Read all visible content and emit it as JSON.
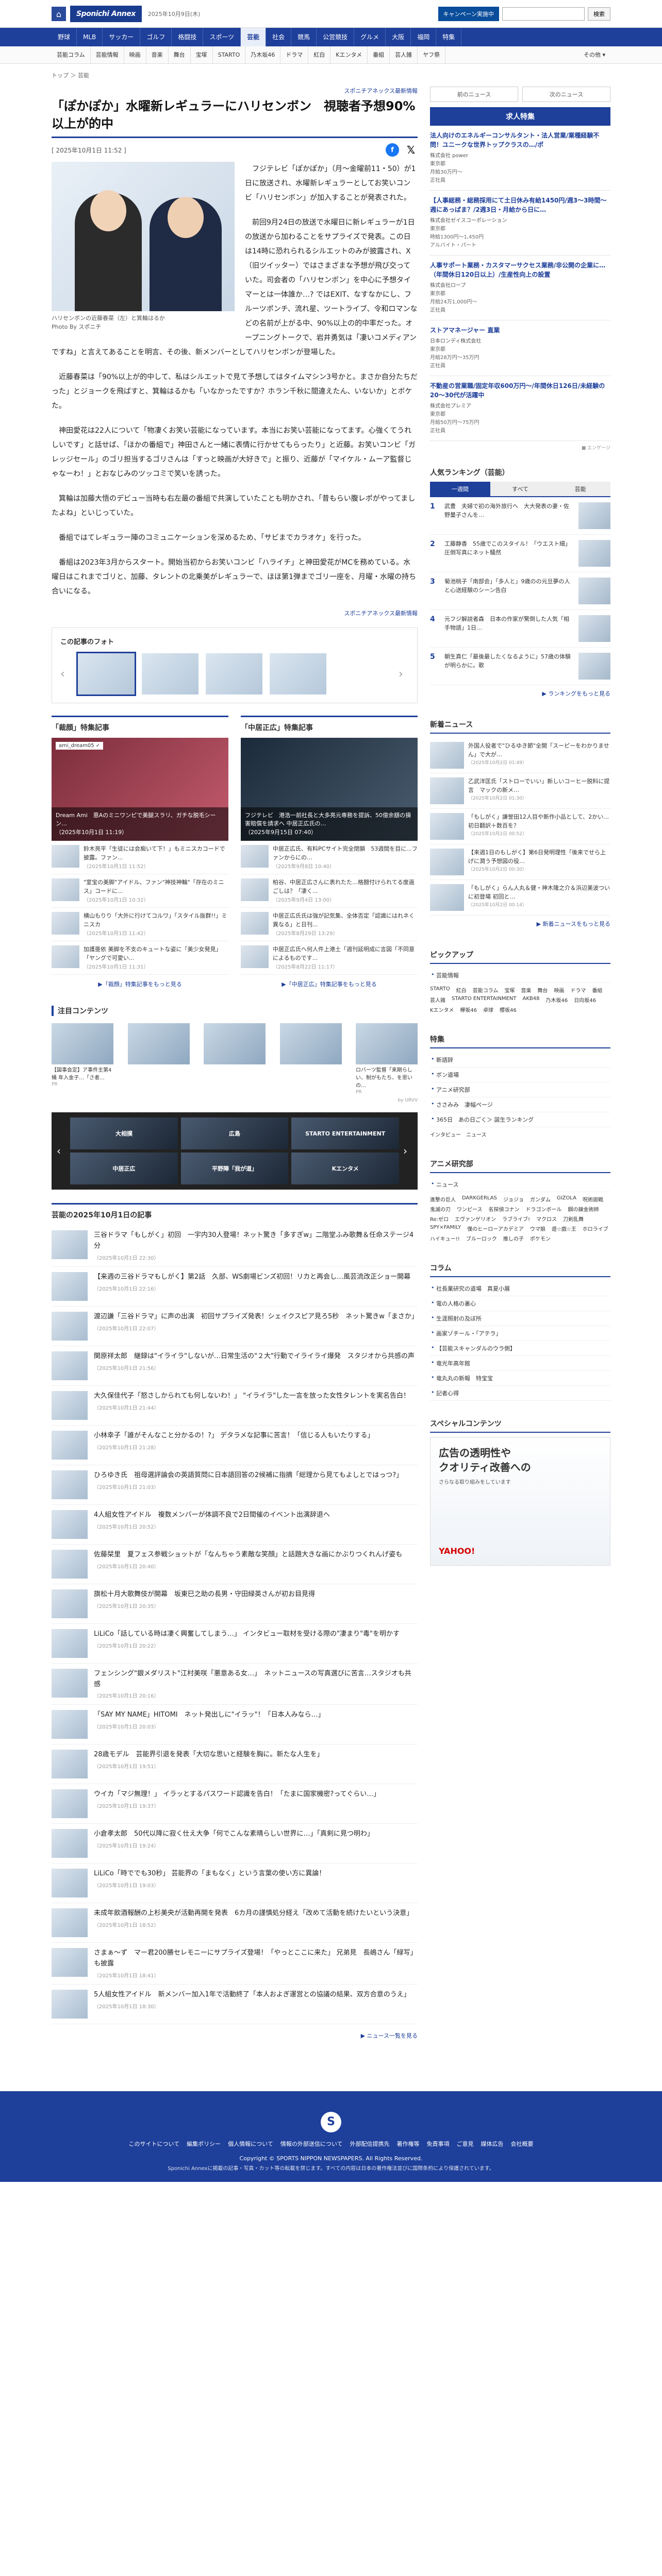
{
  "header": {
    "logo_text": "Sponichi Annex",
    "date": "2025年10月9日(木)",
    "subscribe_label": "キャンペーン実施中",
    "search_placeholder": "",
    "search_button": "検索"
  },
  "nav_main": [
    "野球",
    "MLB",
    "サッカー",
    "ゴルフ",
    "格闘技",
    "スポーツ",
    "芸能",
    "社会",
    "競馬",
    "公営競技",
    "グルメ",
    "大阪",
    "福岡",
    "特集"
  ],
  "nav_main_active": "芸能",
  "nav_sub": [
    "芸能コラム",
    "芸能情報",
    "映画",
    "音楽",
    "舞台",
    "宝塚",
    "STARTO",
    "乃木坂46",
    "ドラマ",
    "紅白",
    "Kエンタメ",
    "番組",
    "芸人雑",
    "ヤフ祭"
  ],
  "nav_sub_more": "その他",
  "breadcrumb": "トップ ＞ 芸能",
  "prev_label": "前のニュース",
  "next_label": "次のニュース",
  "article": {
    "pr_tag": "スポニチアネックス最新情報",
    "title": "「ぽかぽか」水曜新レギュラーにハリセンボン　視聴者予想90%以上が的中",
    "date": "[ 2025年10月1日 11:52 ]",
    "caption": "ハリセンボンの近藤春菜（左）と箕輪はるか\nPhoto By スポニチ",
    "paragraphs": [
      "フジテレビ「ぽかぽか」（月～金曜前11・50）が1日に放送され、水曜新レギュラーとしてお笑いコンビ「ハリセンボン」が加入することが発表された。",
      "前回9月24日の放送で水曜日に新レギュラーが1日の放送から加わることをサプライズで発表。この日は14時に恐れられるシルエットのみが披露され、X（旧ツイッター）ではさまざまな予想が飛び交っていた。司会者の「ハリセンボン」を中心に予想タイマーとは一体誰か…? ではEXIT、なすなかにし、フルーツポンチ、流れ星、ツートライブ、令和ロマンなどの名前が上がる中、90%以上の的中率だった。オープニングトークで、岩井勇気は「凄いコメディアンですね」と言えてあることを明言、その後、新メンバーとしてハリセンボンが登場した。",
      "近藤春菜は「90%以上が的中して、私はシルエットで見て予想してはタイムマシン3号かと。まさか自分たちだった」とジョークを飛ばすと、箕輪はるかも「いなかったですか？ホラン千秋に間違えたん、いないか」とボケた。",
      "神田愛花は22人について「物凄くお笑い芸能になっています。本当にお笑い芸能になってます。心強くてうれしいです」と話せば、「ほかの番組で」神田さんと一緒に表情に行かせてもらったり」と近藤。お笑いコンビ「ガレッジセール」のゴリ担当するゴリさんは「すっと映画が大好きで」と振り、近藤が「マイケル・ムーア監督じゃなーわ！」とおなじみのツッコミで笑いを誘った。",
      "箕輪は加藤大悟のデビュー当時も右左最の番組で共演していたことも明かされ、「昔もらい腹レポがやってましたよね」といじっていた。",
      "番組ではてレギュラー陣のコミュニケーションを深めるため、「サビまでカラオケ」を行った。",
      "番組は2023年3月からスタート。開始当初からお笑いコンビ「ハライチ」と神田愛花がMCを務めている。水曜日はこれまでゴリと、加藤、タレントの北乗美がレギュラーで、ほほ第1弾までゴリ一座を、月曜・水曜の持ち合いになる。"
    ],
    "pr_tag2": "スポニチアネックス最新情報"
  },
  "photo_gallery": {
    "title": "この記事のフォト",
    "count": 4
  },
  "features": [
    {
      "title": "「裁顔」特集記事",
      "hero_tag": "ami_dream05 ✓",
      "hero_text": "Dream Ami　恩Aのミニワンピで美腿スラリ、ガチな脱毛シーン…",
      "hero_date": "（2025年10月1日 11:19）",
      "items": [
        {
          "text": "鈴木亮平「生徒には会痴いて下！」もミニスカコードで披露。ファン...",
          "date": "（2025年10月1日 11:52）"
        },
        {
          "text": "\"室宝の美脚\"アイドル、ファン\"神技神輪\"「存在のミニス」コードに...",
          "date": "（2025年10月1日 10:32）"
        },
        {
          "text": "横山もりり「大外に行けてコルワ」「スタイル抜群!!」ミニスカ",
          "date": "（2025年10月1日 11:42）"
        },
        {
          "text": "加護亜依 美脚を不支のキュートな姿に「美少女発見」「ヤングで可愛い...",
          "date": "（2025年10月1日 11:31）"
        }
      ],
      "more": "▶「裁顔」特集記事をもっと見る"
    },
    {
      "title": "「中居正広」特集記事",
      "hero_tag": "",
      "hero_text": "フジテレビ　港浩一前社長と大多亮元専務を提訴、50億余額の損害賠償を請求へ 中居正広氏の…",
      "hero_date": "（2025年9月15日 07:40）",
      "items": [
        {
          "text": "中居正広氏、有料PCサイト完全閉鎖　53週間を目に...ファンからにの...",
          "date": "（2025年9月8日 10:40）"
        },
        {
          "text": "柏谷、中居正広さんに表れたた…格闘付けられてる度過ごしは？「凄く...",
          "date": "（2025年9月4日 13:00）"
        },
        {
          "text": "中居正広氏氏は強が記気集、全体否定「認識にはれネく異なる」と日刊...",
          "date": "（2025年8月29日 13:29）"
        },
        {
          "text": "中居正広氏へ何人件上港土「週刊延明成に言図「不同意によるものです...",
          "date": "（2025年8月22日 11:17）"
        }
      ],
      "more": "▶「中居正広」特集記事をもっと見る"
    }
  ],
  "attention": {
    "title": "注目コンテンツ",
    "items": [
      {
        "text": "【図事会定】ア事件主第4桶 年入金子…「さ者...",
        "pr": "PR"
      },
      {
        "text": "",
        "pr": ""
      },
      {
        "text": "",
        "pr": ""
      },
      {
        "text": "",
        "pr": ""
      },
      {
        "text": "ロバーツ監督「来期らしい、制がもたち、を思いの…",
        "pr": "PR"
      }
    ],
    "credit": "by URVV"
  },
  "carousel": [
    "大相撲",
    "広島",
    "STARTO ENTERTAINMENT",
    "中居正広",
    "平野陣「我が道」",
    "Kエンタメ"
  ],
  "news_list": {
    "title": "芸能の2025年10月1日の記事",
    "items": [
      {
        "title": "三谷ドラマ「もしがく」初回　一宇内30人登場！ネット驚き「多すぎw」二階堂ふみ歌舞＆任命ステージ4分",
        "date": "（2025年10月1日 22:30）"
      },
      {
        "title": "【来週の三谷ドラマもしがく】第2話　久部、WS劇場ビンズ初回！リカと再会し…風芸流改正ショー開幕",
        "date": "（2025年10月1日 22:16）"
      },
      {
        "title": "渡辺謙「三谷ドラマ」に声の出演　初回サプライズ発表！シェイクスピア見ろ5秒　ネット驚きw「まさか」",
        "date": "（2025年10月1日 22:07）"
      },
      {
        "title": "関原祥太郎　継録は\"イライラ\"しないが…日常生活の\"２大\"行動でイライライ爆発　スタジオから共感の声",
        "date": "（2025年10月1日 21:56）"
      },
      {
        "title": "大久保佳代子「怒さしかられても何しないわ！」 \"イライラ\"した一言を放った女性タレントを実名告白！",
        "date": "（2025年10月1日 21:44）"
      },
      {
        "title": "小林幸子「誰がそんなこと分かるの！?」 デタラメな記事に苦言！「信じる人もいたりする」",
        "date": "（2025年10月1日 21:28）"
      },
      {
        "title": "ひろゆき氏　祖母選評論会の英語質問に日本語回答の2候補に指摘「総理から見てもよしとではっつ?」",
        "date": "（2025年10月1日 21:03）"
      },
      {
        "title": "4人組女性アイドル　複数メンバーが体調不良で2日間催のイベント出演辞退へ",
        "date": "（2025年10月1日 20:52）"
      },
      {
        "title": "佐藤栞里　夏フェス参戦ショットが「なんちゃう素敵な笑顔」と話題大きな画にかぶりつくれんげ姿も",
        "date": "（2025年10月1日 20:40）"
      },
      {
        "title": "旗松十月大歌舞伎が開幕　坂東巳之助の長男・守田緑英さんが初お目見得",
        "date": "（2025年10月1日 20:35）"
      },
      {
        "title": "LiLiCo「話している時は凄く興奮してしまう…」 インタビュー取材を受ける際の\"凄まり\"毒\"を明かす",
        "date": "（2025年10月1日 20:22）"
      },
      {
        "title": "フェンシング\"銀メダリスト\"江村美咲「悪意ある女…」　ネットニュースの写真選びに苦言…スタジオも共感",
        "date": "（2025年10月1日 20:16）"
      },
      {
        "title": "「SAY MY NAME」HITOMI　ネット発出しに\"イラッ\"！「日本人みなら…」",
        "date": "（2025年10月1日 20:03）"
      },
      {
        "title": "28歳モデル　芸能界引退を発表「大切な思いと経験を胸に。新たな人生を」",
        "date": "（2025年10月1日 19:51）"
      },
      {
        "title": "ウイカ「マジ無理！」 イラッとするパスワード認識を告白！「たまに国家機密?ってぐらい…」",
        "date": "（2025年10月1日 19:37）"
      },
      {
        "title": "小倉孝太郎　50代以降に寂く仕え大争「何でこんな素晴らしい世界に…」「真剣に見つ明わ」",
        "date": "（2025年10月1日 19:24）"
      },
      {
        "title": "LiLiCo「時ででも30秒」 芸能界の「まもなく」という言葉の使い方に異論！",
        "date": "（2025年10月1日 19:03）"
      },
      {
        "title": "未成年飲酒報酬の上杉美央が活動再開を発表　6カ月の謹慎処分経え「改めて活動を続けたいという決意」",
        "date": "（2025年10月1日 18:52）"
      },
      {
        "title": "さまぁ～ず　マー君200勝セレモニーにサプライズ登場！「やっとここに来た」 兄弟見　長嶋さん「緑写」も披露",
        "date": "（2025年10月1日 18:41）"
      },
      {
        "title": "5人組女性アイドル　新メンバー加入1年で活動終了「本人およぎ運営との協議の結果、双方合意のうえ」",
        "date": "（2025年10月1日 18:30）"
      }
    ],
    "more": "▶ ニュース一覧を見る"
  },
  "sidebar": {
    "prev": "前のニュース",
    "next": "次のニュース",
    "jobs_title": "求人特集",
    "jobs": [
      {
        "title": "法人向けのエネルギーコンサルタント・法人営業/業種経験不問！ユニークな世界トップクラスの…/ポ",
        "co": "株式会社 power",
        "det": "東京都\n月給30万円～\n正社員"
      },
      {
        "title": "【人事総務・総務採用にて土日休み有給1450円/週3～3時間～週にあっぱま？/2週3日・月給から日に…",
        "co": "株式会社ゼイスコーポレーション",
        "det": "東京都\n時給1300円～1,450円\nアルバイト・パート"
      },
      {
        "title": "人事サポート業務・カスタマーサクセス業務/非公開の企業に…（年間休日120日以上）/生産性向上の設置",
        "co": "株式会社ロープ",
        "det": "東京都\n月給24万1,000円～\n正社員"
      },
      {
        "title": "ストアマネージャー 直業",
        "co": "日本ロンディ株式会社",
        "det": "東京都\n月給28万円～35万円\n正社員"
      },
      {
        "title": "不動産の営業職/固定年収600万円～/年間休日126日/未経験の20～30代が活躍中",
        "co": "株式会社プレミア",
        "det": "東京都\n月給50万円～75万円\n正社員"
      }
    ],
    "jobs_credit": "■ エンゲージ",
    "ranking_title": "人気ランキング（芸能）",
    "ranking_tabs": [
      "一週間",
      "すべて",
      "芸能"
    ],
    "ranking_active": 0,
    "ranking": [
      {
        "no": "1",
        "text": "武豊　夫婦で初の海外旅行へ　大大発表の妻・佐野量子さんを…"
      },
      {
        "no": "2",
        "text": "工藤静香　55歳でこのスタイル！「ウエスト細」圧倒写真にネット騒然"
      },
      {
        "no": "3",
        "text": "菊池桃子「南部会」「多人と」9歳のの元旦夢の人と心送経験のシーン告白"
      },
      {
        "no": "4",
        "text": "元フジ解説者森　日本の作家が驚倒した人気「相手物語」1日…"
      },
      {
        "no": "5",
        "text": "朝生真仁「最後最したくなるように」57歳の体験が明らかに。歌"
      }
    ],
    "ranking_more": "▶ ランキングをもっと見る",
    "new_title": "新着ニュース",
    "new_items": [
      {
        "text": "外国人役者で\"ひるゆき節\"全開「スーピーをわかりません」で大が…",
        "date": "（2025年10月2日 01:49）"
      },
      {
        "text": "乙武洋匡氏「ストローでいい」新しいコーヒー脱料に提言　マックの新メ…",
        "date": "（2025年10月2日 01:30）"
      },
      {
        "text": "「もしがく」謙誉田12人目や新作小品として、2かい…初日翻訳＋数百を？",
        "date": "（2025年10月2日 00:52）"
      },
      {
        "text": "【来週1日のもしがく】第6日発明理性「後来でせら上げに潤う予想図の役…",
        "date": "（2025年10月2日 00:30）"
      },
      {
        "text": "「もしがく」らん人丸＆健・神木隆之介＆浜辺美波ついに初登場 初回と…",
        "date": "（2025年10月2日 00:14）"
      }
    ],
    "new_more": "▶ 新着ニュースをもっと見る",
    "pickup_title": "ピックアップ",
    "pickup_links": [
      "芸能情報"
    ],
    "pickup_tags": [
      "STARTO",
      "紅白",
      "芸能コラム",
      "宝塚",
      "音楽",
      "舞台",
      "映画",
      "ドラマ",
      "番組",
      "芸人雑",
      "STARTO ENTERTAINMENT",
      "AKB48",
      "乃木坂46",
      "日向坂46",
      "Kエンタメ",
      "欅坂46",
      "卓球",
      "櫻坂46"
    ],
    "special_title": "特集",
    "special_links": [
      "新語辞",
      "ボン道場",
      "アニメ研究部",
      "ささみみ　凄幅ページ",
      "365日　あの日ごく＞ 誕生ランキング"
    ],
    "special_extra": "インタビュー　ニュース",
    "anime_title": "アニメ研究部",
    "anime_links": [
      "ニュース"
    ],
    "anime_tags": [
      "進撃の巨人",
      "DARKGERLAS",
      "ジョジョ",
      "ガンダム",
      "GIZOLA",
      "呪術廻戦",
      "鬼滅の刃",
      "ワンピース",
      "名探偵コナン",
      "ドラゴンボール",
      "鋼の錬金術師",
      "Re:ゼロ",
      "エヴァンゲリオン",
      "ラブライブ!",
      "マクロス",
      "刀剣乱舞",
      "SPY×FAMILY",
      "僕のヒーローアカデミア",
      "ウマ娘",
      "遊☆戯☆王",
      "ホロライブ",
      "ハイキュー!!",
      "ブルーロック",
      "推しの子",
      "ポケモン"
    ],
    "column_title": "コラム",
    "column_links": [
      "社長業研究の道場　真夏小展",
      "電の人格の裏心",
      "生涯照射の及ぼ所",
      "画家ゾチール・「アテラ」",
      "【芸能スキャンダルのウラ側】",
      "竜光年高年館",
      "竜丸丸の新報　特宝宝",
      "記者心得"
    ],
    "special_content_title": "スペシャルコンテンツ",
    "ad_line1": "広告の透明性や",
    "ad_line2": "クオリティ改善への",
    "ad_sub": "さらなる取り組みをしています",
    "ad_brand": "YAHOO!"
  },
  "footer": {
    "logo": "S",
    "links": [
      "このサイトについて",
      "編集ポリシー",
      "個人情報について",
      "情報の外部送信について",
      "外部配信提携先",
      "著作権等",
      "免責事項",
      "ご意見",
      "媒体広告",
      "会社概要"
    ],
    "copyright": "Copyright © SPORTS NIPPON NEWSPAPERS. All Rights Reserved.",
    "note": "Sponichi Annexに掲載の記事・写真・カット等の転載を禁じます。すべての内容は日本の著作権法並びに国際条約により保護されています。"
  }
}
